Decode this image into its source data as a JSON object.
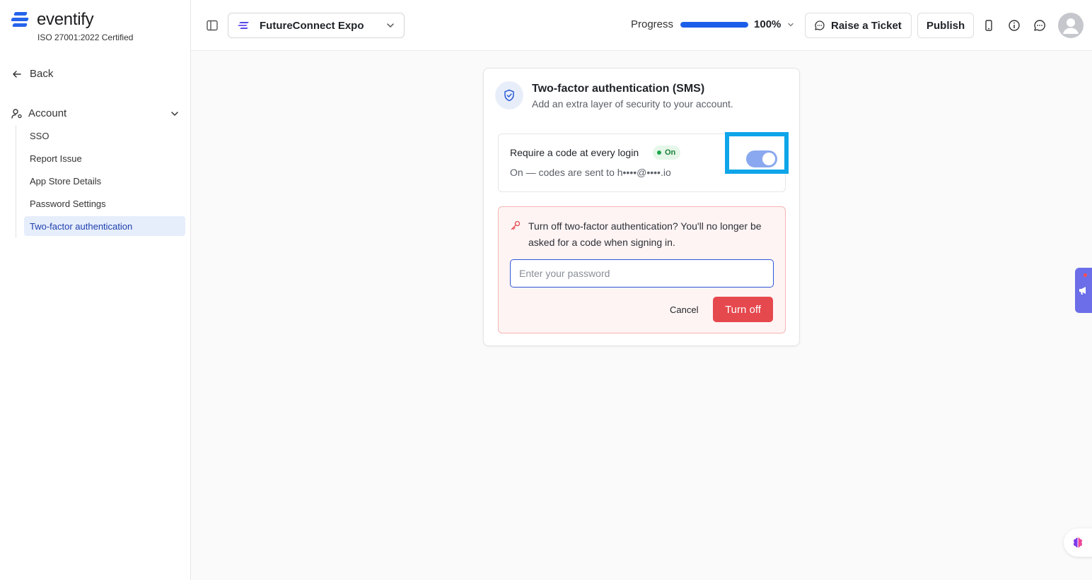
{
  "brand": {
    "name": "eventify",
    "certification": "ISO 27001:2022 Certified",
    "accent_color": "#2563eb"
  },
  "sidebar": {
    "back_label": "Back",
    "section_label": "Account",
    "items": [
      {
        "label": "SSO",
        "active": false
      },
      {
        "label": "Report Issue",
        "active": false
      },
      {
        "label": "App Store Details",
        "active": false
      },
      {
        "label": "Password Settings",
        "active": false
      },
      {
        "label": "Two-factor authentication",
        "active": true
      }
    ]
  },
  "header": {
    "event_name": "FutureConnect Expo",
    "progress_label": "Progress",
    "progress_value": 100,
    "progress_text": "100%",
    "raise_ticket_label": "Raise a Ticket",
    "publish_label": "Publish",
    "icons": [
      "sidebar-toggle-icon",
      "mobile-preview-icon",
      "info-icon",
      "chat-icon",
      "avatar"
    ]
  },
  "card": {
    "title": "Two-factor authentication (SMS)",
    "subtitle": "Add an extra layer of security to your account.",
    "require": {
      "title": "Require a code at every login",
      "badge": "On",
      "status_text": "On — codes are sent to h••••@••••.io",
      "toggle_on": true
    },
    "confirm": {
      "message": "Turn off two-factor authentication? You'll no longer be asked for a code when signing in.",
      "password_placeholder": "Enter your password",
      "password_value": "",
      "cancel_label": "Cancel",
      "turn_off_label": "Turn off",
      "danger_color": "#e5484d"
    }
  }
}
